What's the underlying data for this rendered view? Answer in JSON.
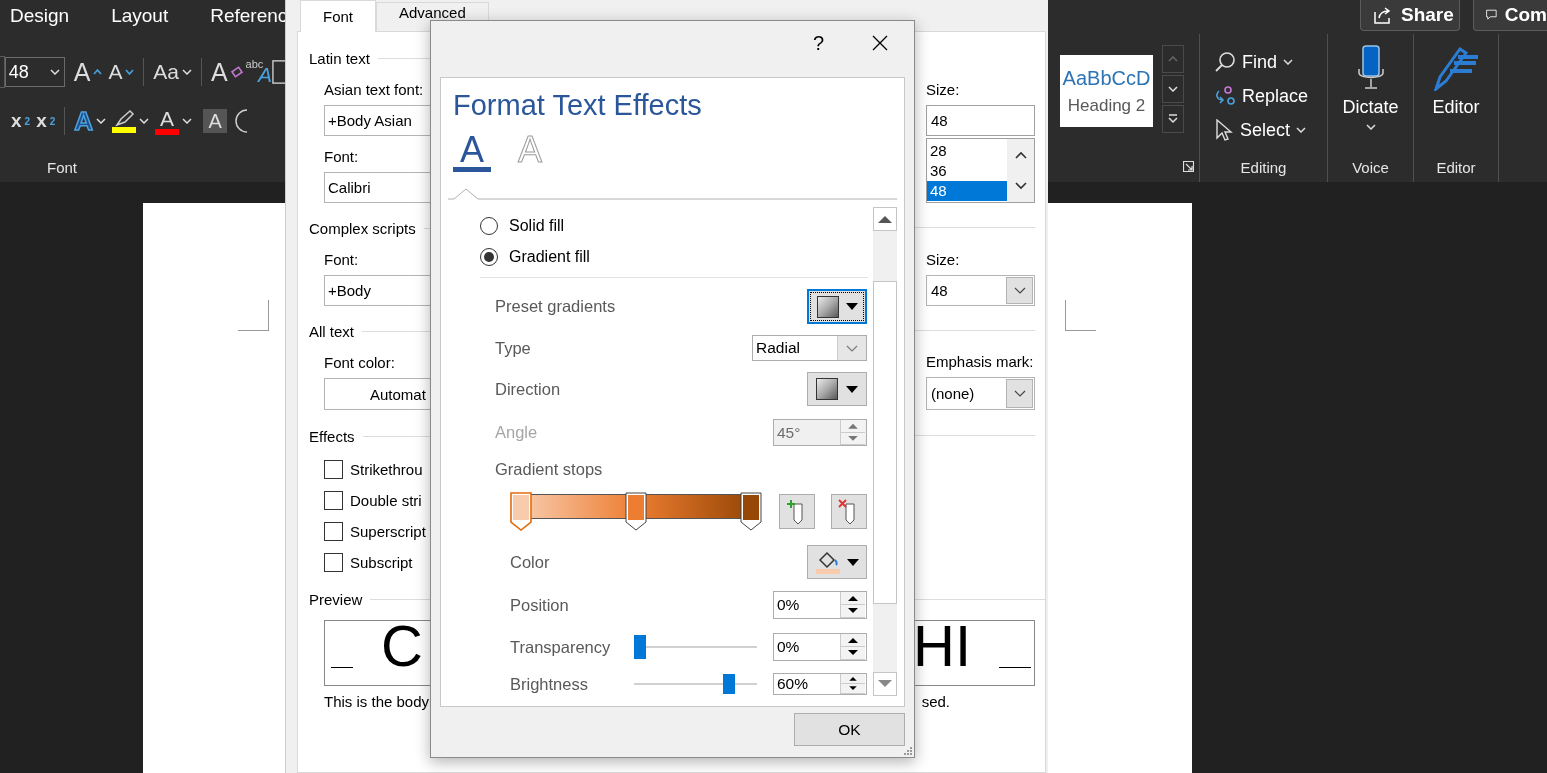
{
  "ribbon": {
    "tabs": [
      {
        "label": "Design",
        "selected": false
      },
      {
        "label": "Layout",
        "selected": false
      },
      {
        "label": "Referenc",
        "selected": false
      }
    ],
    "share_button": "Share",
    "comments_button": "Com",
    "font_group": {
      "label": "Font",
      "font_size": "48",
      "grow_font": "A",
      "shrink_font": "A",
      "change_case": "Aa",
      "clear_glyph": "A",
      "phonetic_small": "abc",
      "phonetic_glyph": "A",
      "subscript": {
        "base": "x",
        "index": "2"
      },
      "superscript": {
        "base": "x",
        "index": "2"
      },
      "text_effects_glyph": "A",
      "font_color_glyph": "A",
      "shading_glyph": "A"
    },
    "styles": {
      "sample": "AaBbCcD",
      "name": "Heading 2",
      "scroll_up_disabled": true
    },
    "editing": {
      "label": "Editing",
      "items": [
        {
          "kind": "find",
          "label": "Find",
          "dropdown": true
        },
        {
          "kind": "replace",
          "label": "Replace",
          "dropdown": false
        },
        {
          "kind": "select",
          "label": "Select",
          "dropdown": true
        }
      ]
    },
    "voice": {
      "label": "Voice",
      "button": "Dictate"
    },
    "editor": {
      "label": "Editor",
      "button": "Editor"
    }
  },
  "font_dialog": {
    "tabs": [
      {
        "label": "Font",
        "selected": true
      },
      {
        "label": "Advanced",
        "selected": false
      }
    ],
    "latin": {
      "heading": "Latin text",
      "asian_font": {
        "label": "Asian text font:",
        "value": "+Body Asian"
      },
      "font": {
        "label": "Font:",
        "value": "Calibri"
      },
      "size": {
        "label": "Size:",
        "value": "48",
        "options": [
          {
            "label": "28",
            "selected": false
          },
          {
            "label": "36",
            "selected": false
          },
          {
            "label": "48",
            "selected": true
          }
        ]
      }
    },
    "complex": {
      "heading": "Complex scripts",
      "font": {
        "label": "Font:",
        "value": "+Body"
      },
      "size": {
        "label": "Size:",
        "value": "48"
      }
    },
    "all_text": {
      "heading": "All text",
      "font_color": {
        "label": "Font color:",
        "value": "Automat"
      },
      "emphasis": {
        "label": "Emphasis mark:",
        "value": "(none)"
      }
    },
    "effects": {
      "heading": "Effects",
      "items": [
        {
          "label": "Strikethrou",
          "checked": false
        },
        {
          "label": "Double stri",
          "checked": false
        },
        {
          "label": "Superscript",
          "checked": false
        },
        {
          "label": "Subscript",
          "checked": false
        }
      ]
    },
    "preview": {
      "heading": "Preview",
      "start": "C",
      "end": "HI",
      "note_start": "This is the body",
      "note_end": "sed."
    }
  },
  "effects_dialog": {
    "help": "?",
    "title": "Format Text Effects",
    "effect_tabs": [
      {
        "kind": "fill",
        "glyph": "A",
        "selected": true
      },
      {
        "kind": "outline",
        "glyph": "A",
        "selected": false
      }
    ],
    "fill_options": [
      {
        "label": "Solid fill",
        "selected": false
      },
      {
        "label": "Gradient fill",
        "selected": true
      }
    ],
    "preset": {
      "label": "Preset gradients",
      "focused": true
    },
    "type": {
      "label": "Type",
      "value": "Radial"
    },
    "direction": {
      "label": "Direction"
    },
    "angle": {
      "label": "Angle",
      "value": "45°",
      "disabled": true
    },
    "stops_label": "Gradient stops",
    "stops": [
      {
        "color": "#f8cbad",
        "selected": true
      },
      {
        "color": "#ed7d31",
        "selected": false
      },
      {
        "color": "#974706",
        "selected": false
      }
    ],
    "color": {
      "label": "Color",
      "color": "#f8cbad"
    },
    "position": {
      "label": "Position",
      "value": "0%"
    },
    "transparency": {
      "label": "Transparency",
      "value": "0%",
      "level": 0
    },
    "brightness": {
      "label": "Brightness",
      "value": "60%",
      "level": 0.8
    },
    "ok": "OK"
  }
}
